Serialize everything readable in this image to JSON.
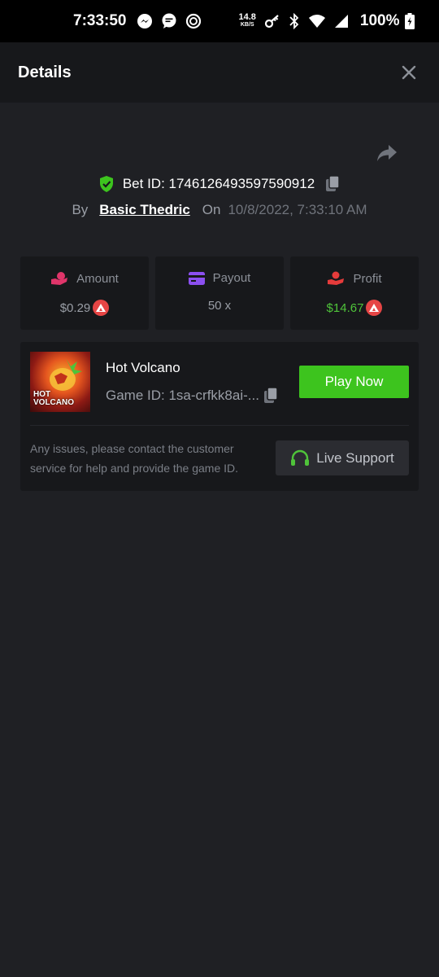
{
  "status_bar": {
    "time": "7:33:50",
    "net_speed_value": "14.8",
    "net_speed_unit": "KB/S",
    "battery": "100%"
  },
  "header": {
    "title": "Details"
  },
  "bet": {
    "bet_id_label": "Bet ID: 1746126493597590912",
    "by_label": "By",
    "user": "Basic Thedric",
    "on_label": "On",
    "date": "10/8/2022, 7:33:10 AM"
  },
  "stats": [
    {
      "label": "Amount",
      "value": "$0.29",
      "icon": "money-hand-icon",
      "color": "#e0356a"
    },
    {
      "label": "Payout",
      "value": "50 x",
      "icon": "card-icon",
      "color": "#8b4ff0"
    },
    {
      "label": "Profit",
      "value": "$14.67",
      "icon": "profit-hand-icon",
      "color": "#e63b3b"
    }
  ],
  "game": {
    "name": "Hot Volcano",
    "game_id": "Game ID: 1sa-crfkk8ai-...",
    "thumb_text": "HOT VOLCANO",
    "play_label": "Play Now",
    "help_text": "Any issues, please contact the customer service for help and provide the game ID.",
    "support_label": "Live Support"
  },
  "colors": {
    "accent_green": "#3dc41e",
    "profit_green": "#4fc33a",
    "coin_red": "#e64545",
    "background": "#1f2024",
    "panel": "#17181b"
  }
}
